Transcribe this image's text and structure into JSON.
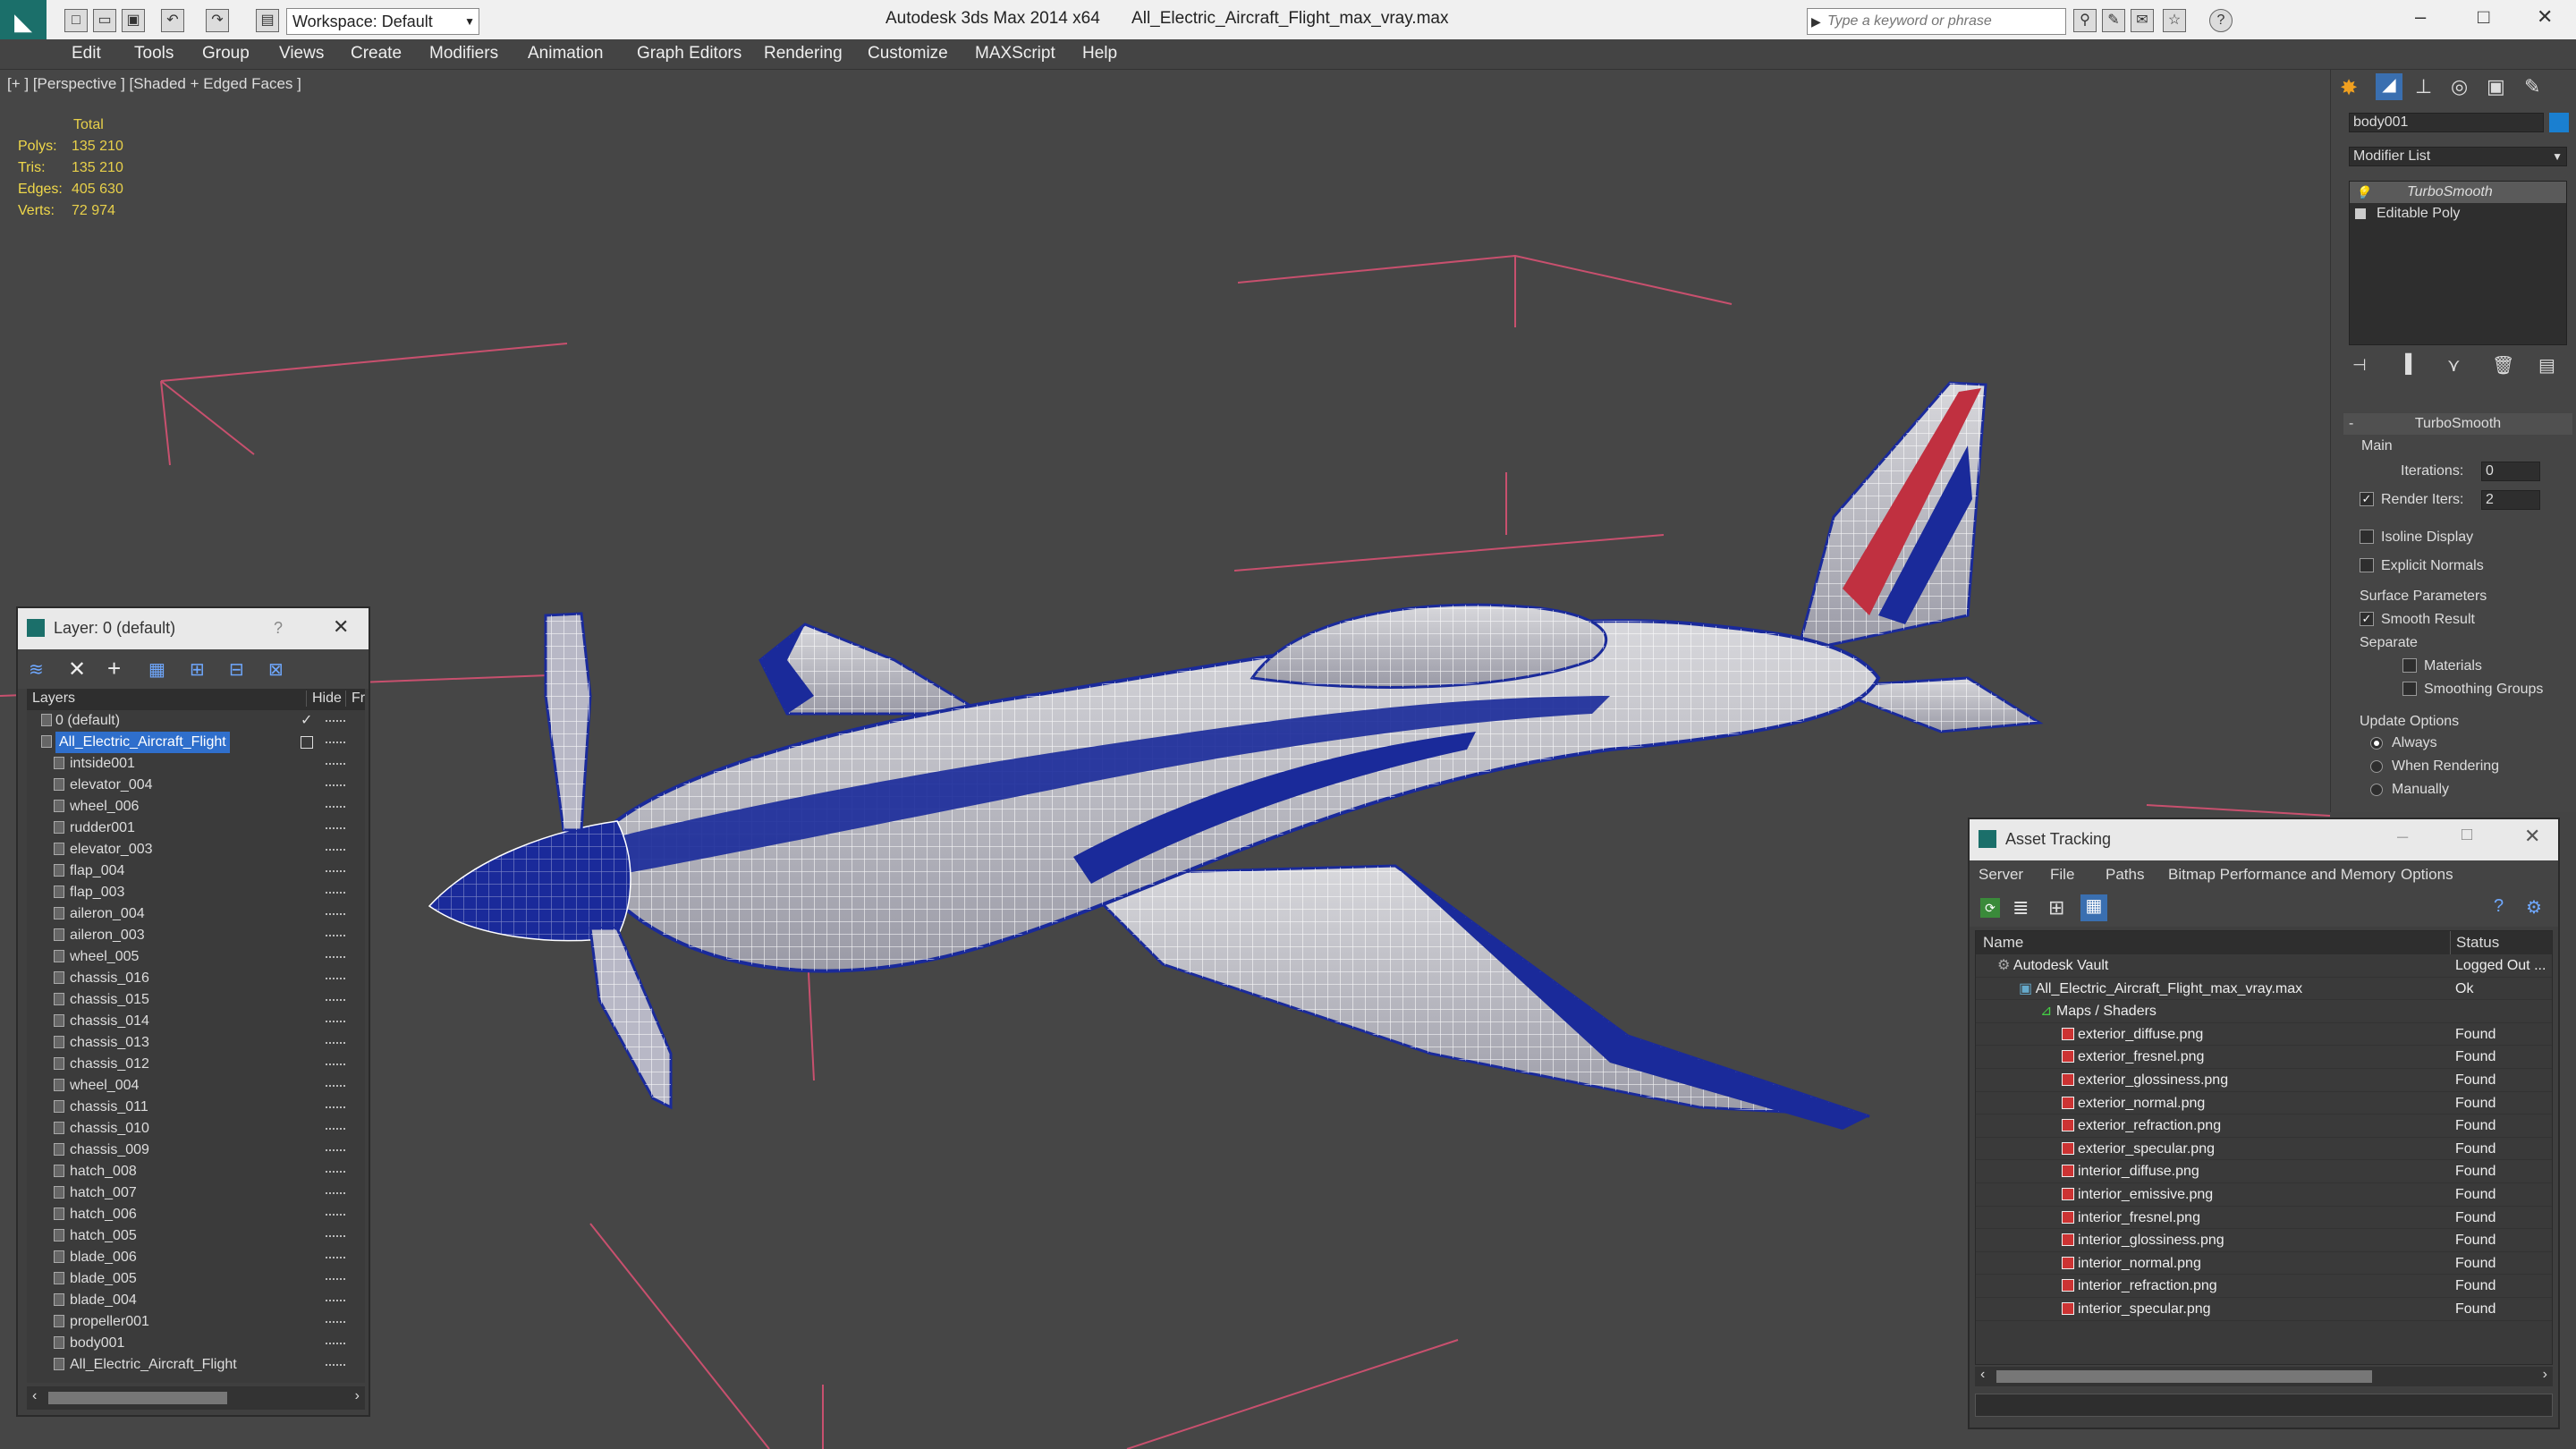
{
  "titlebar": {
    "app_title": "Autodesk 3ds Max  2014 x64",
    "file_name": "All_Electric_Aircraft_Flight_max_vray.max",
    "workspace": "Workspace: Default",
    "search_placeholder": "Type a keyword or phrase"
  },
  "menu": [
    "Edit",
    "Tools",
    "Group",
    "Views",
    "Create",
    "Modifiers",
    "Animation",
    "Graph Editors",
    "Rendering",
    "Customize",
    "MAXScript",
    "Help"
  ],
  "viewport": {
    "label": "[+ ] [Perspective ] [Shaded + Edged Faces ]",
    "stats": {
      "header": "Total",
      "polys_label": "Polys:",
      "polys": "135 210",
      "tris_label": "Tris:",
      "tris": "135 210",
      "edges_label": "Edges:",
      "edges": "405 630",
      "verts_label": "Verts:",
      "verts": "72 974"
    }
  },
  "layer_window": {
    "title": "Layer: 0 (default)",
    "help": "?",
    "col_layers": "Layers",
    "col_hide": "Hide",
    "col_fr": "Fr",
    "rows": [
      {
        "name": "0 (default)",
        "type": "layer"
      },
      {
        "name": "All_Electric_Aircraft_Flight",
        "type": "layer-selected"
      },
      {
        "name": "intside001",
        "type": "obj"
      },
      {
        "name": "elevator_004",
        "type": "obj"
      },
      {
        "name": "wheel_006",
        "type": "obj"
      },
      {
        "name": "rudder001",
        "type": "obj"
      },
      {
        "name": "elevator_003",
        "type": "obj"
      },
      {
        "name": "flap_004",
        "type": "obj"
      },
      {
        "name": "flap_003",
        "type": "obj"
      },
      {
        "name": "aileron_004",
        "type": "obj"
      },
      {
        "name": "aileron_003",
        "type": "obj"
      },
      {
        "name": "wheel_005",
        "type": "obj"
      },
      {
        "name": "chassis_016",
        "type": "obj"
      },
      {
        "name": "chassis_015",
        "type": "obj"
      },
      {
        "name": "chassis_014",
        "type": "obj"
      },
      {
        "name": "chassis_013",
        "type": "obj"
      },
      {
        "name": "chassis_012",
        "type": "obj"
      },
      {
        "name": "wheel_004",
        "type": "obj"
      },
      {
        "name": "chassis_011",
        "type": "obj"
      },
      {
        "name": "chassis_010",
        "type": "obj"
      },
      {
        "name": "chassis_009",
        "type": "obj"
      },
      {
        "name": "hatch_008",
        "type": "obj"
      },
      {
        "name": "hatch_007",
        "type": "obj"
      },
      {
        "name": "hatch_006",
        "type": "obj"
      },
      {
        "name": "hatch_005",
        "type": "obj"
      },
      {
        "name": "blade_006",
        "type": "obj"
      },
      {
        "name": "blade_005",
        "type": "obj"
      },
      {
        "name": "blade_004",
        "type": "obj"
      },
      {
        "name": "propeller001",
        "type": "obj"
      },
      {
        "name": "body001",
        "type": "obj"
      },
      {
        "name": "All_Electric_Aircraft_Flight",
        "type": "obj"
      }
    ]
  },
  "command_panel": {
    "object_name": "body001",
    "modifier_list": "Modifier List",
    "stack": [
      "TurboSmooth",
      "Editable Poly"
    ],
    "rollout_title": "TurboSmooth",
    "main_label": "Main",
    "iterations_label": "Iterations:",
    "iterations": "0",
    "render_iters_label": "Render Iters:",
    "render_iters": "2",
    "isoline": "Isoline Display",
    "explicit_normals": "Explicit Normals",
    "surface_params": "Surface Parameters",
    "smooth_result": "Smooth Result",
    "separate": "Separate",
    "materials": "Materials",
    "smoothing_groups": "Smoothing Groups",
    "update_options": "Update Options",
    "always": "Always",
    "when_rendering": "When Rendering",
    "manually": "Manually"
  },
  "asset_tracking": {
    "title": "Asset Tracking",
    "menu": [
      "Server",
      "File",
      "Paths",
      "Bitmap Performance and Memory",
      "Options"
    ],
    "col_name": "Name",
    "col_status": "Status",
    "rows": [
      {
        "name": "Autodesk Vault",
        "status": "Logged Out ...",
        "level": 0,
        "kind": "vault"
      },
      {
        "name": "All_Electric_Aircraft_Flight_max_vray.max",
        "status": "Ok",
        "level": 1,
        "kind": "max"
      },
      {
        "name": "Maps / Shaders",
        "status": "",
        "level": 2,
        "kind": "folder"
      },
      {
        "name": "exterior_diffuse.png",
        "status": "Found",
        "level": 3,
        "kind": "png"
      },
      {
        "name": "exterior_fresnel.png",
        "status": "Found",
        "level": 3,
        "kind": "png"
      },
      {
        "name": "exterior_glossiness.png",
        "status": "Found",
        "level": 3,
        "kind": "png"
      },
      {
        "name": "exterior_normal.png",
        "status": "Found",
        "level": 3,
        "kind": "png"
      },
      {
        "name": "exterior_refraction.png",
        "status": "Found",
        "level": 3,
        "kind": "png"
      },
      {
        "name": "exterior_specular.png",
        "status": "Found",
        "level": 3,
        "kind": "png"
      },
      {
        "name": "interior_diffuse.png",
        "status": "Found",
        "level": 3,
        "kind": "png"
      },
      {
        "name": "interior_emissive.png",
        "status": "Found",
        "level": 3,
        "kind": "png"
      },
      {
        "name": "interior_fresnel.png",
        "status": "Found",
        "level": 3,
        "kind": "png"
      },
      {
        "name": "interior_glossiness.png",
        "status": "Found",
        "level": 3,
        "kind": "png"
      },
      {
        "name": "interior_normal.png",
        "status": "Found",
        "level": 3,
        "kind": "png"
      },
      {
        "name": "interior_refraction.png",
        "status": "Found",
        "level": 3,
        "kind": "png"
      },
      {
        "name": "interior_specular.png",
        "status": "Found",
        "level": 3,
        "kind": "png"
      }
    ]
  },
  "colors": {
    "accent_blue": "#2f6fcc",
    "stats_yellow": "#f0d84a",
    "aircraft_blue": "#1a2a9a",
    "grid_pink": "#d05070"
  }
}
